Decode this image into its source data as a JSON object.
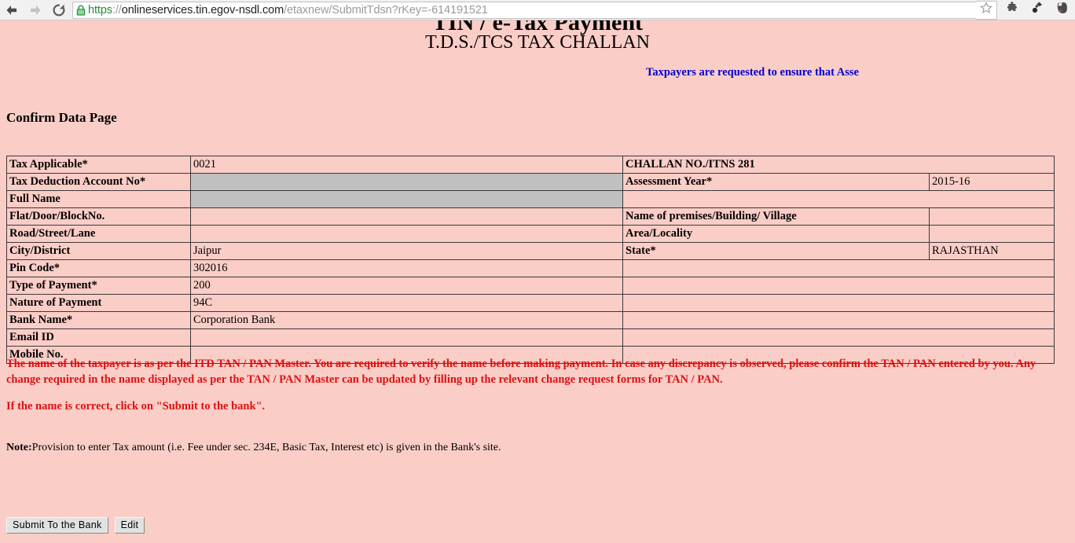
{
  "browser": {
    "back_icon": "arrow-left-icon",
    "forward_icon": "arrow-right-icon",
    "reload_icon": "reload-icon",
    "lock_icon": "lock-icon",
    "url_scheme": "https",
    "url_separator": "://",
    "url_host": "onlineservices.tin.egov-nsdl.com",
    "url_path": "/etaxnew/SubmitTdsn?rKey=-614191521",
    "url_full": "https://onlineservices.tin.egov-nsdl.com/etaxnew/SubmitTdsn?rKey=-614191521",
    "star_icon": "star-bookmark-icon",
    "extension_icon": "puzzle-piece-extension-icon",
    "lamp_icon": "lamp-extension-icon",
    "evernote_icon": "evernote-elephant-icon"
  },
  "page": {
    "clipped_title": "TIN / e-Tax Payment",
    "challan_title": "T.D.S./TCS TAX CHALLAN",
    "blue_notice": "Taxpayers are requested to ensure that Asse",
    "confirm_heading": "Confirm Data Page"
  },
  "table": {
    "rows": [
      {
        "label": "Tax Applicable*",
        "value": "0021",
        "value_grey": false,
        "right_label": "CHALLAN NO./ITNS 281",
        "right_value": "",
        "right_span": true,
        "right_label_bold": true
      },
      {
        "label": "Tax Deduction Account No*",
        "value": "",
        "value_grey": true,
        "right_label": "Assessment Year*",
        "right_value": "2015-16",
        "right_span": false,
        "right_label_bold": true
      },
      {
        "label": "Full Name",
        "value": "",
        "value_grey": true,
        "right_label": "",
        "right_value": "",
        "right_span": true,
        "right_label_bold": false
      },
      {
        "label": "Flat/Door/BlockNo.",
        "value": "",
        "value_grey": false,
        "right_label": "Name of premises/Building/ Village",
        "right_value": "",
        "right_span": false,
        "right_label_bold": true
      },
      {
        "label": "Road/Street/Lane",
        "value": "",
        "value_grey": false,
        "right_label": "Area/Locality",
        "right_value": "",
        "right_span": false,
        "right_label_bold": true
      },
      {
        "label": "City/District",
        "value": "Jaipur",
        "value_grey": false,
        "right_label": "State*",
        "right_value": "RAJASTHAN",
        "right_span": false,
        "right_label_bold": true
      },
      {
        "label": "Pin Code*",
        "value": "302016",
        "value_grey": false,
        "right_label": "",
        "right_value": "",
        "right_span": true,
        "right_label_bold": false
      },
      {
        "label": "Type of Payment*",
        "value": "200",
        "value_grey": false,
        "right_label": "",
        "right_value": "",
        "right_span": true,
        "right_label_bold": false
      },
      {
        "label": "Nature of Payment",
        "value": "94C",
        "value_grey": false,
        "right_label": "",
        "right_value": "",
        "right_span": true,
        "right_label_bold": false
      },
      {
        "label": "Bank Name*",
        "value": "Corporation Bank",
        "value_grey": false,
        "right_label": "",
        "right_value": "",
        "right_span": true,
        "right_label_bold": false
      },
      {
        "label": "Email ID",
        "value": "",
        "value_grey": false,
        "right_label": "",
        "right_value": "",
        "right_span": true,
        "right_label_bold": false
      },
      {
        "label": "Mobile No.",
        "value": "",
        "value_grey": false,
        "right_label": "",
        "right_value": "",
        "right_span": true,
        "right_label_bold": false
      }
    ]
  },
  "messages": {
    "red_warning": "The name of the taxpayer is as per the ITD TAN / PAN Master. You are required to verify the name before making payment. In case any discrepancy is observed, please confirm the TAN / PAN entered by you. Any change required in the name displayed as per the TAN / PAN Master can be updated by filling up the relevant change request forms for TAN / PAN.",
    "red_confirm_line": "If the name is correct, click on \"Submit to the bank\".",
    "note_label": "Note:",
    "note_text": "Provision to enter Tax amount (i.e. Fee under sec. 234E, Basic Tax, Interest etc) is given in the Bank's site."
  },
  "buttons": {
    "submit_label": "Submit To the Bank",
    "edit_label": "Edit"
  },
  "colors": {
    "page_background": "#fbcdc7",
    "disabled_cell": "#c0c0c0",
    "warning_red": "#dd1111",
    "notice_blue": "#0000cc",
    "table_border": "#3a3a3a"
  }
}
